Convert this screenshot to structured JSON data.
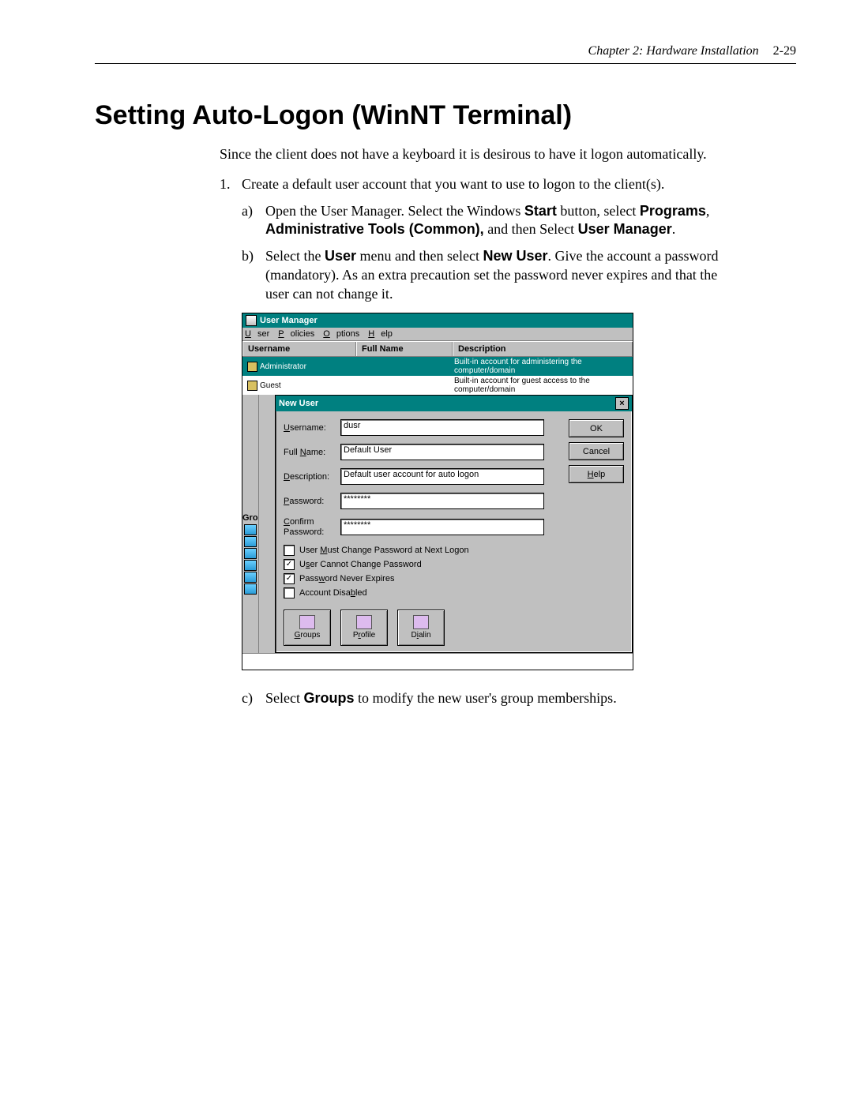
{
  "header": {
    "chapter": "Chapter 2: Hardware Installation",
    "page": "2-29"
  },
  "title": "Setting Auto-Logon (WinNT Terminal)",
  "intro": "Since the client does not have a keyboard it is desirous to have it logon automatically.",
  "steps": {
    "s1": "Create a default user account that you want to use to logon to the client(s).",
    "a_pre": "Open the User Manager. Select the Windows ",
    "a_start": "Start",
    "a_mid1": " button, select ",
    "a_progs": "Programs",
    "a_mid2": ", ",
    "a_admin": "Administrative Tools (Common),",
    "a_mid3": " and then Select ",
    "a_um": "User Manager",
    "a_end": ".",
    "b_pre": "Select the ",
    "b_user": "User",
    "b_mid1": " menu and then select ",
    "b_new": "New User",
    "b_rest": ". Give the account a password (mandatory). As an extra precaution set the password never expires and that the user can not change it.",
    "c_pre": "Select ",
    "c_groups": "Groups",
    "c_rest": " to modify the new user's group memberships."
  },
  "win": {
    "title": "User Manager",
    "menu": {
      "user": "User",
      "policies": "Policies",
      "options": "Options",
      "help": "Help"
    },
    "columns": {
      "username": "Username",
      "fullname": "Full Name",
      "description": "Description"
    },
    "rows": [
      {
        "user": "Administrator",
        "full": "",
        "desc": "Built-in account for administering the computer/domain"
      },
      {
        "user": "Guest",
        "full": "",
        "desc": "Built-in account for guest access to the computer/domain"
      }
    ],
    "groups_label": "Gro"
  },
  "dlg": {
    "title": "New User",
    "labels": {
      "username": "Username:",
      "fullname": "Full Name:",
      "description": "Description:",
      "password": "Password:",
      "confirm": "Confirm Password:"
    },
    "values": {
      "username": "dusr",
      "fullname": "Default User",
      "description": "Default user account for auto logon",
      "password": "********",
      "confirm": "********"
    },
    "checks": {
      "must_change": "User Must Change Password at Next Logon",
      "cannot_change": "User Cannot Change Password",
      "never_expires": "Password Never Expires",
      "disabled": "Account Disabled"
    },
    "buttons": {
      "ok": "OK",
      "cancel": "Cancel",
      "help": "Help"
    },
    "tools": {
      "groups": "Groups",
      "profile": "Profile",
      "dialin": "Dialin"
    }
  }
}
